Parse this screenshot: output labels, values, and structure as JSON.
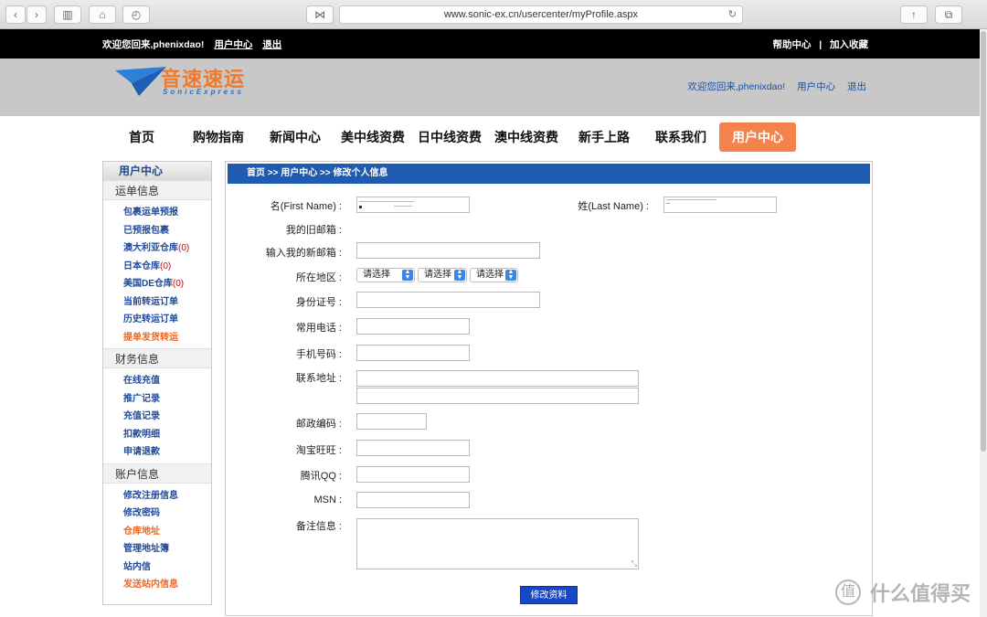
{
  "browser": {
    "url": "www.sonic-ex.cn/usercenter/myProfile.aspx"
  },
  "topbar": {
    "welcome": "欢迎您回来,phenixdao!",
    "user_center": "用户中心",
    "logout": "退出",
    "help": "帮助中心",
    "separator": "|",
    "bookmark": "加入收藏"
  },
  "header": {
    "brand": "音速速运",
    "brand_sub": "SonicExpress",
    "welcome": "欢迎您回来,phenixdao!",
    "user_center": "用户中心",
    "logout": "退出"
  },
  "nav": [
    "首页",
    "购物指南",
    "新闻中心",
    "美中线资费",
    "日中线资费",
    "澳中线资费",
    "新手上路",
    "联系我们",
    "用户中心"
  ],
  "sidebar": {
    "title": "用户中心",
    "sections": [
      {
        "heading": "运单信息",
        "links": [
          {
            "label": "包裹运单预报"
          },
          {
            "label": "已预报包裹"
          },
          {
            "label": "澳大利亚仓库",
            "count": "(0)"
          },
          {
            "label": "日本仓库",
            "count": "(0)"
          },
          {
            "label": "美国DE仓库",
            "count": "(0)"
          },
          {
            "label": "当前转运订单"
          },
          {
            "label": "历史转运订单"
          },
          {
            "label": "提单发货转运",
            "orange": true
          }
        ]
      },
      {
        "heading": "财务信息",
        "links": [
          {
            "label": "在线充值"
          },
          {
            "label": "推广记录"
          },
          {
            "label": "充值记录"
          },
          {
            "label": "扣款明细"
          },
          {
            "label": "申请退款"
          }
        ]
      },
      {
        "heading": "账户信息",
        "links": [
          {
            "label": "修改注册信息"
          },
          {
            "label": "修改密码"
          },
          {
            "label": "仓库地址",
            "orange": true
          },
          {
            "label": "管理地址簿"
          },
          {
            "label": "站内信"
          },
          {
            "label": "发送站内信息",
            "orange": true
          }
        ]
      }
    ]
  },
  "form": {
    "breadcrumb": "首页 >> 用户中心 >> 修改个人信息",
    "first_name_label": "名(First Name) :",
    "last_name_label": "姓(Last Name) :",
    "old_email_label": "我的旧邮箱 :",
    "new_email_label": "输入我的新邮箱 :",
    "region_label": "所在地区 :",
    "region_select_1": "请选择",
    "region_select_2": "请选择",
    "region_select_3": "请选择",
    "id_label": "身份证号 :",
    "phone_label": "常用电话 :",
    "mobile_label": "手机号码 :",
    "address_label": "联系地址 :",
    "zip_label": "邮政编码 :",
    "taobao_label": "淘宝旺旺 :",
    "qq_label": "腾讯QQ :",
    "msn_label": "MSN :",
    "note_label": "备注信息 :",
    "submit": "修改资料"
  },
  "watermark": {
    "badge": "值",
    "text": "什么值得买"
  }
}
